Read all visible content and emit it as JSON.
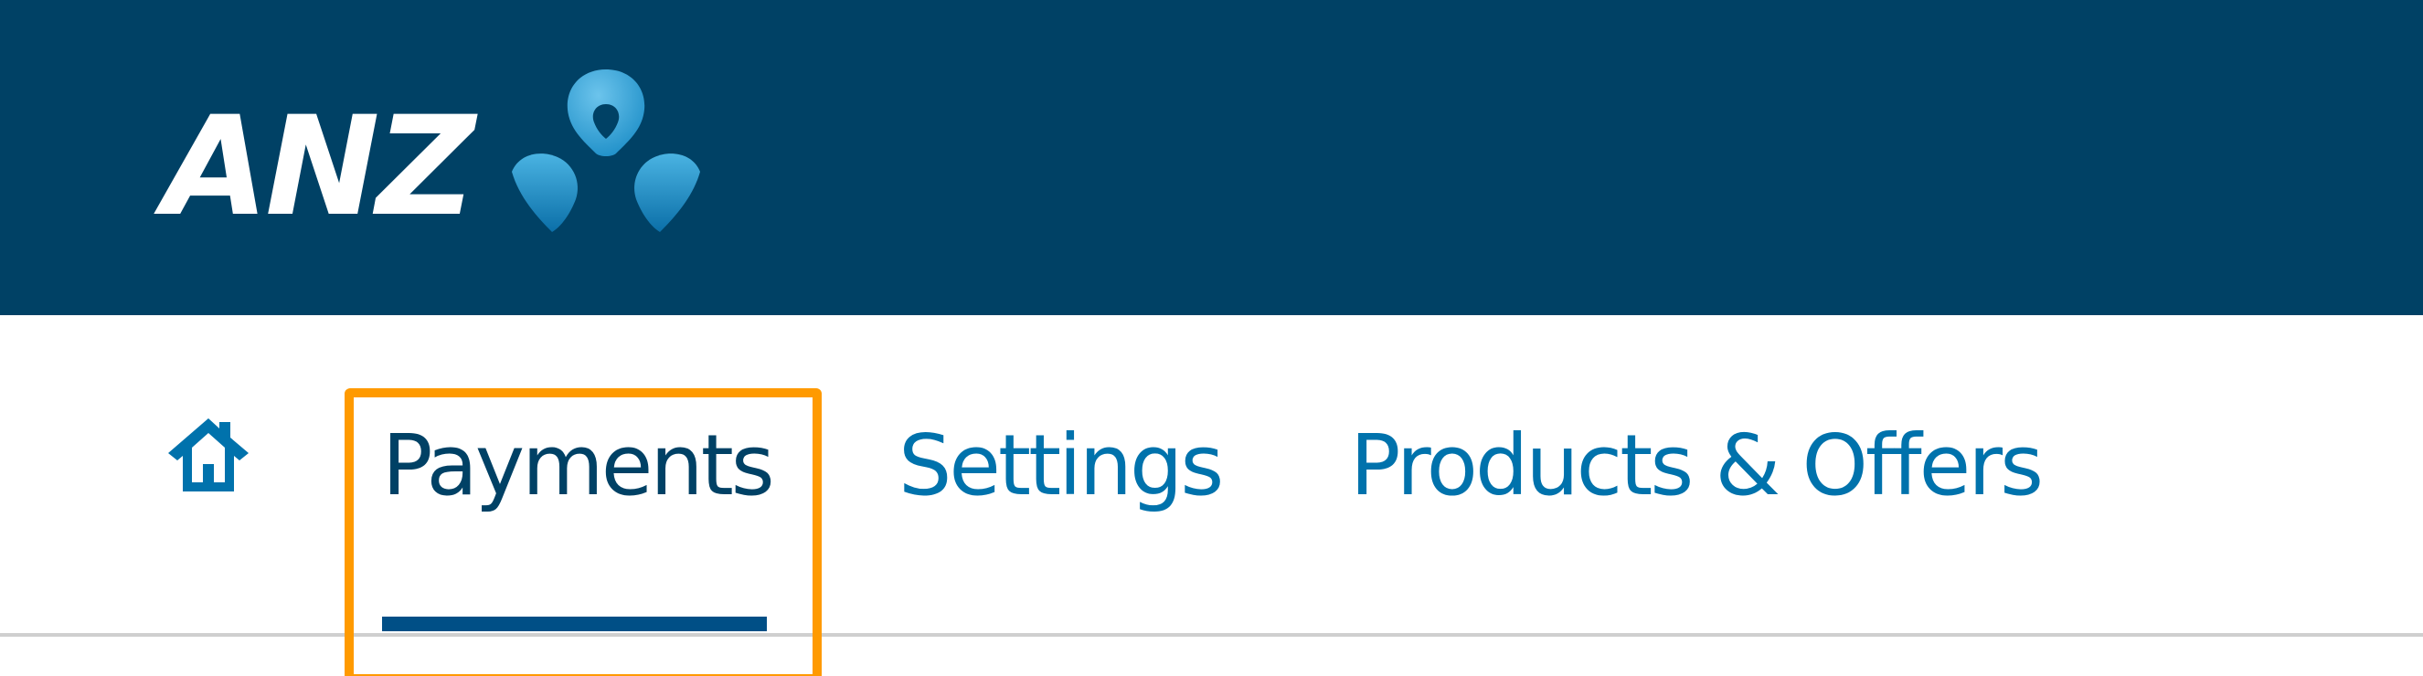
{
  "header": {
    "logo_text": "ANZ",
    "logo_alt": "ANZ logo",
    "background_color": "#004165",
    "accent_color": "#0072ac"
  },
  "nav": {
    "home_icon": "home-icon",
    "tabs": [
      {
        "id": "payments",
        "label": "Payments",
        "active": true
      },
      {
        "id": "settings",
        "label": "Settings",
        "active": false
      },
      {
        "id": "products",
        "label": "Products & Offers",
        "active": false
      }
    ]
  },
  "highlight": {
    "target": "payments",
    "color": "#ff9a00"
  }
}
